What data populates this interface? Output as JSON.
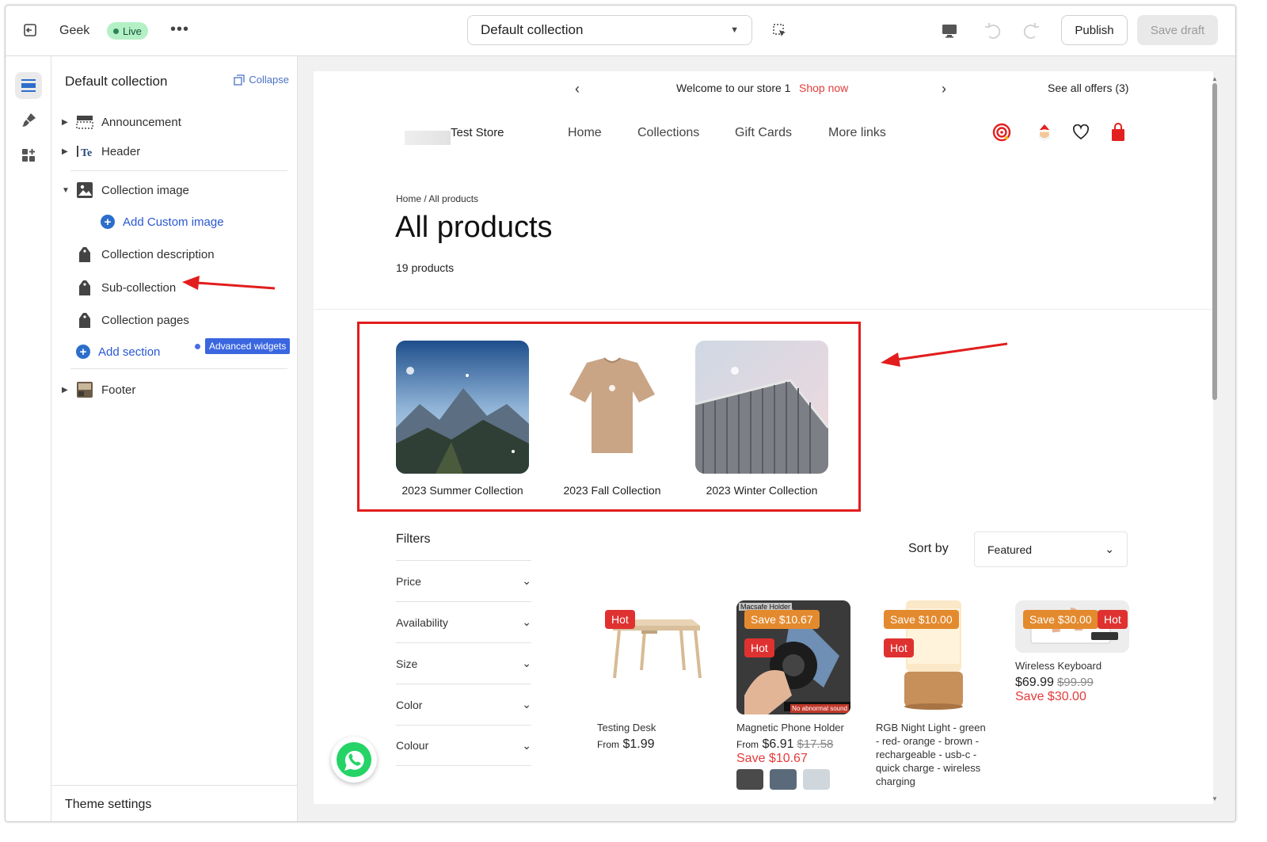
{
  "topbar": {
    "theme_name": "Geek",
    "live_badge": "Live",
    "more_label": "•••",
    "template_select": "Default collection",
    "publish_label": "Publish",
    "save_draft_label": "Save draft"
  },
  "sidebar": {
    "title": "Default collection",
    "collapse_label": "Collapse",
    "items": [
      {
        "label": "Announcement"
      },
      {
        "label": "Header"
      },
      {
        "label": "Collection image"
      },
      {
        "label": "Add Custom image"
      },
      {
        "label": "Collection description"
      },
      {
        "label": "Sub-collection"
      },
      {
        "label": "Collection pages"
      },
      {
        "label": "Add section"
      },
      {
        "label": "Footer"
      }
    ],
    "advanced_widgets": "Advanced widgets",
    "theme_settings": "Theme settings"
  },
  "store": {
    "announcement": {
      "text": "Welcome to our store 1",
      "link": "Shop now",
      "offers": "See all offers (3)",
      "prev": "‹",
      "next": "›"
    },
    "logo_text": "Test Store",
    "nav": [
      "Home",
      "Collections",
      "Gift Cards",
      "More links"
    ],
    "breadcrumb": "Home / All products",
    "page_title": "All products",
    "product_count": "19 products",
    "subcollections": [
      {
        "label": "2023 Summer Collection"
      },
      {
        "label": "2023 Fall Collection"
      },
      {
        "label": "2023 Winter Collection"
      }
    ],
    "filters_title": "Filters",
    "filters": [
      "Price",
      "Availability",
      "Size",
      "Color",
      "Colour"
    ],
    "sort_label": "Sort by",
    "sort_value": "Featured",
    "products": [
      {
        "name": "Testing Desk",
        "price_prefix": "From",
        "price": "$1.99",
        "compare": "",
        "save": "",
        "badges": [
          "Hot"
        ]
      },
      {
        "name": "Magnetic Phone Holder",
        "price_prefix": "From",
        "price": "$6.91",
        "compare": "$17.58",
        "save": "Save $10.67",
        "badges": [
          "Save $10.67",
          "Hot"
        ],
        "image_text": "Macsafe Holder",
        "image_caption": "No abnormal sound"
      },
      {
        "name": "RGB Night Light - green - red- orange - brown - rechargeable - usb-c - quick charge - wireless charging",
        "price_prefix": "",
        "price": "",
        "compare": "",
        "save": "",
        "badges": [
          "Save $10.00",
          "Hot"
        ]
      },
      {
        "name": "Wireless Keyboard",
        "price_prefix": "",
        "price": "$69.99",
        "compare": "$99.99",
        "save": "Save $30.00",
        "badges": [
          "Save $30.00",
          "Hot"
        ]
      }
    ]
  },
  "colors": {
    "accent_red": "#e21d1d",
    "badge_orange": "#e38a2e",
    "badge_red": "#e03131",
    "link_blue": "#2a58d2",
    "live_green": "#b4f0c6"
  }
}
